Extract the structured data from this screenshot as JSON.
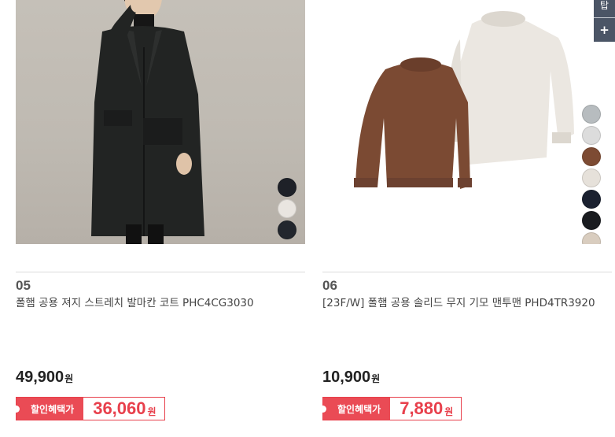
{
  "products": [
    {
      "number": "05",
      "name": "폴햄 공용 져지 스트레치 발마칸 코트 PHC4CG3030",
      "price": "49,900",
      "price_unit": "원",
      "benefit_label": "할인혜택가",
      "benefit_price": "36,060",
      "benefit_unit": "원",
      "swatches": [
        "#1e2128",
        "#e9e5e0",
        "#22262d"
      ]
    },
    {
      "number": "06",
      "name": "[23F/W] 폴햄 공용 솔리드 무지 기모 맨투맨 PHD4TR3920",
      "price": "10,900",
      "price_unit": "원",
      "benefit_label": "할인혜택가",
      "benefit_price": "7,880",
      "benefit_unit": "원",
      "swatches": [
        "#b7bcbf",
        "#dcdcdc",
        "#7d4b33",
        "#e6e1da",
        "#1b2130",
        "#1a1c20",
        "#d9cdbf"
      ]
    }
  ],
  "side_widget": {
    "top_label": "탑",
    "plus_label": "+"
  }
}
